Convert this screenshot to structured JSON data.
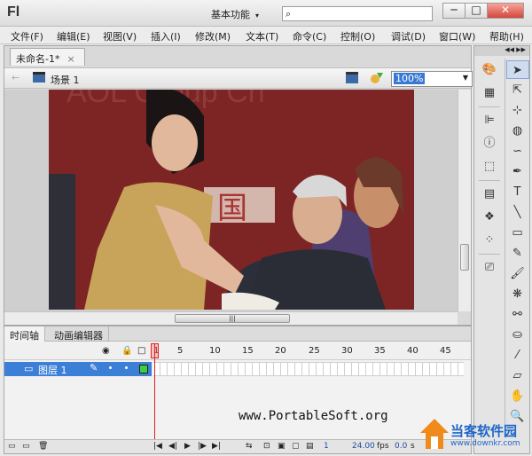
{
  "app": {
    "logo": "Fl",
    "workspace": "基本功能",
    "search_placeholder": ""
  },
  "window_buttons": {
    "minimize": "─",
    "maximize": "□",
    "close": "✕"
  },
  "menu": [
    "文件(F)",
    "编辑(E)",
    "视图(V)",
    "插入(I)",
    "修改(M)",
    "文本(T)",
    "命令(C)",
    "控制(O)",
    "调试(D)",
    "窗口(W)",
    "帮助(H)"
  ],
  "document": {
    "tab_label": "未命名-1*",
    "tab_close": "×",
    "scene_label": "场景 1",
    "zoom": "100%"
  },
  "stage_image": {
    "banner_text_top": "AOL Group Cn",
    "banner_text_mid": "国",
    "description": "photo"
  },
  "timeline": {
    "tabs": [
      "时间轴",
      "动画编辑器"
    ],
    "frame_numbers": [
      "1",
      "5",
      "10",
      "15",
      "20",
      "25",
      "30",
      "35",
      "40",
      "45"
    ],
    "layer_name": "图层 1",
    "current_frame": "1",
    "fps": "24.00",
    "fps_unit": "fps",
    "time": "0.0",
    "time_unit": "s"
  },
  "watermark": "www.PortableSoft.org",
  "corner_logo": {
    "name": "当客软件园",
    "url": "www.downkr.com"
  },
  "tools": {
    "panel_icons": [
      "palette-icon",
      "grid-icon",
      "align-icon",
      "info-icon",
      "transform-icon",
      "library-icon",
      "components-icon",
      "motion-icon",
      "movie-icon"
    ],
    "toolbar_icons": [
      "selection-tool-icon",
      "subselection-tool-icon",
      "free-transform-icon",
      "3d-rotation-icon",
      "lasso-icon",
      "pen-icon",
      "text-tool-icon",
      "line-tool-icon",
      "rectangle-tool-icon",
      "pencil-tool-icon",
      "brush-tool-icon",
      "deco-tool-icon",
      "bone-tool-icon",
      "paint-bucket-icon",
      "eyedropper-icon",
      "eraser-icon",
      "hand-tool-icon",
      "zoom-tool-icon"
    ]
  },
  "colors": {
    "selection_blue": "#3c7fd6",
    "banner_red": "#7f2626",
    "playhead_red": "#dd2222"
  }
}
